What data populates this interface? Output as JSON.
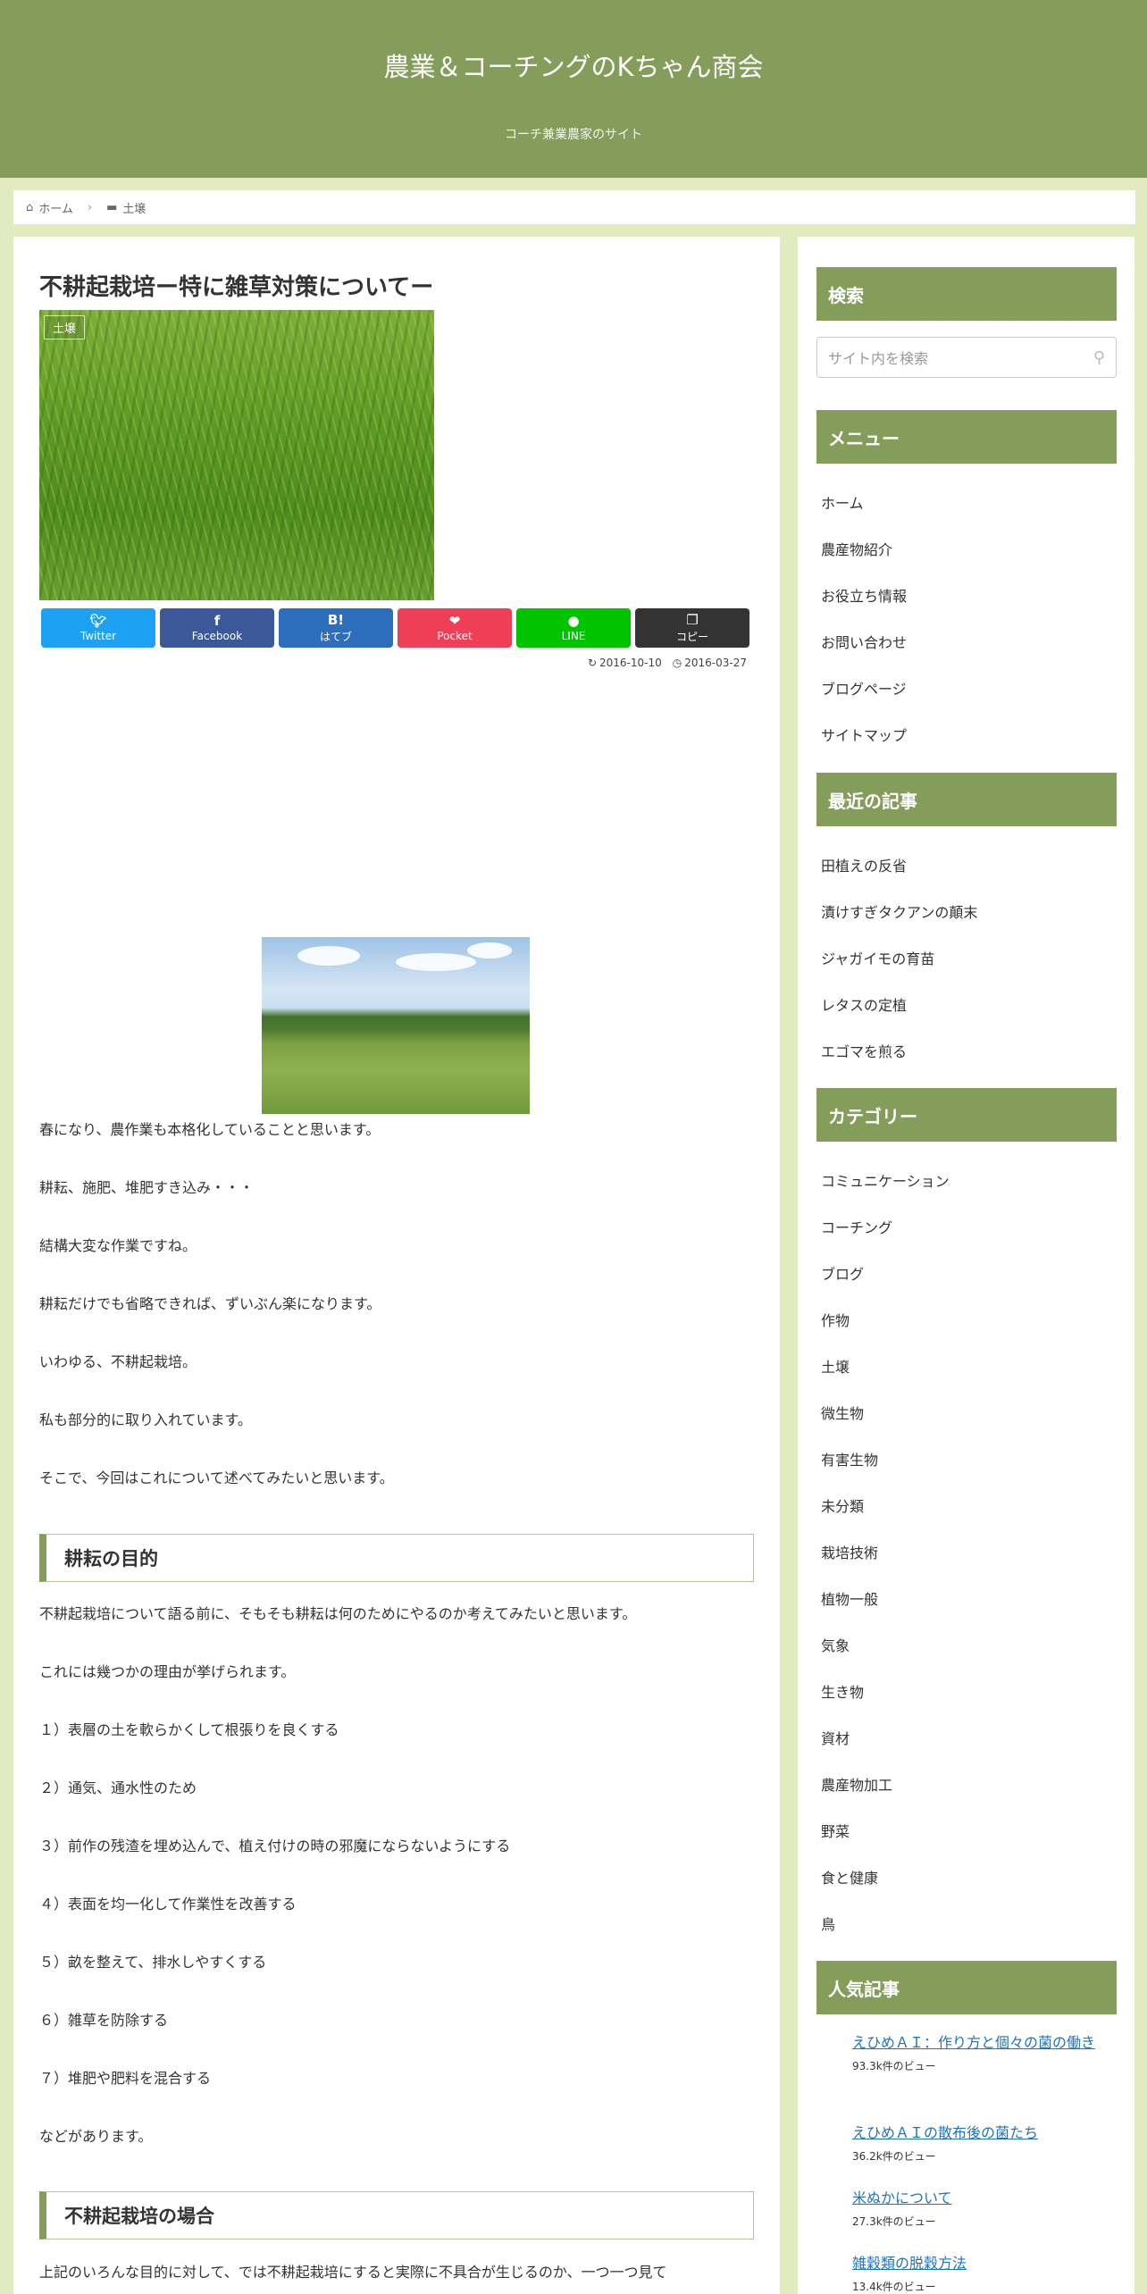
{
  "header": {
    "site_title": "農業＆コーチングのKちゃん商会",
    "tagline": "コーチ兼業農家のサイト",
    "bg_color": "#859d5b"
  },
  "breadcrumb": {
    "home": "ホーム",
    "category": "土壌",
    "home_icon": "home-icon",
    "folder_icon": "folder-icon"
  },
  "post": {
    "title": "不耕起栽培ー特に雑草対策についてー",
    "category_label": "土壌",
    "share": {
      "twitter": "Twitter",
      "facebook": "Facebook",
      "hatena": "はてブ",
      "hatena_glyph": "B!",
      "pocket": "Pocket",
      "line": "LINE",
      "copy": "コピー"
    },
    "updated_date": "2016-10-10",
    "published_date": "2016-03-27",
    "paragraphs": [
      "春になり、農作業も本格化していることと思います。",
      "耕耘、施肥、堆肥すき込み・・・",
      "結構大変な作業ですね。",
      "耕耘だけでも省略できれば、ずいぶん楽になります。",
      "いわゆる、不耕起栽培。",
      "私も部分的に取り入れています。",
      "そこで、今回はこれについて述べてみたいと思います。"
    ],
    "section1_heading": "耕耘の目的",
    "section1_paragraphs": [
      "不耕起栽培について語る前に、そもそも耕耘は何のためにやるのか考えてみたいと思います。",
      "これには幾つかの理由が挙げられます。",
      "１）表層の土を軟らかくして根張りを良くする",
      "２）通気、通水性のため",
      "３）前作の残渣を埋め込んで、植え付けの時の邪魔にならないようにする",
      "４）表面を均一化して作業性を改善する",
      "５）畝を整えて、排水しやすくする",
      "６）雑草を防除する",
      "７）堆肥や肥料を混合する",
      "などがあります。"
    ],
    "section2_heading": "不耕起栽培の場合",
    "section2_paragraph": "上記のいろんな目的に対して、では不耕起栽培にすると実際に不具合が生じるのか、一つ一つ見て"
  },
  "sidebar": {
    "search": {
      "heading": "検索",
      "placeholder": "サイト内を検索"
    },
    "menu": {
      "heading": "メニュー",
      "items": [
        "ホーム",
        "農産物紹介",
        "お役立ち情報",
        "お問い合わせ",
        "ブログページ",
        "サイトマップ"
      ]
    },
    "recent": {
      "heading": "最近の記事",
      "items": [
        "田植えの反省",
        "漬けすぎタクアンの顛末",
        "ジャガイモの育苗",
        "レタスの定植",
        "エゴマを煎る"
      ]
    },
    "categories": {
      "heading": "カテゴリー",
      "items": [
        "コミュニケーション",
        "コーチング",
        "ブログ",
        "作物",
        "土壌",
        "微生物",
        "有害生物",
        "未分類",
        "栽培技術",
        "植物一般",
        "気象",
        "生き物",
        "資材",
        "農産物加工",
        "野菜",
        "食と健康",
        "鳥"
      ]
    },
    "popular": {
      "heading": "人気記事",
      "items": [
        {
          "title": "えひめＡＩ：作り方と個々の菌の働き",
          "views": "93.3k件のビュー"
        },
        {
          "title": "えひめＡＩの散布後の菌たち",
          "views": "36.2k件のビュー"
        },
        {
          "title": "米ぬかについて",
          "views": "27.3k件のビュー"
        },
        {
          "title": "雑穀類の脱穀方法",
          "views": "13.4k件のビュー"
        }
      ]
    }
  }
}
